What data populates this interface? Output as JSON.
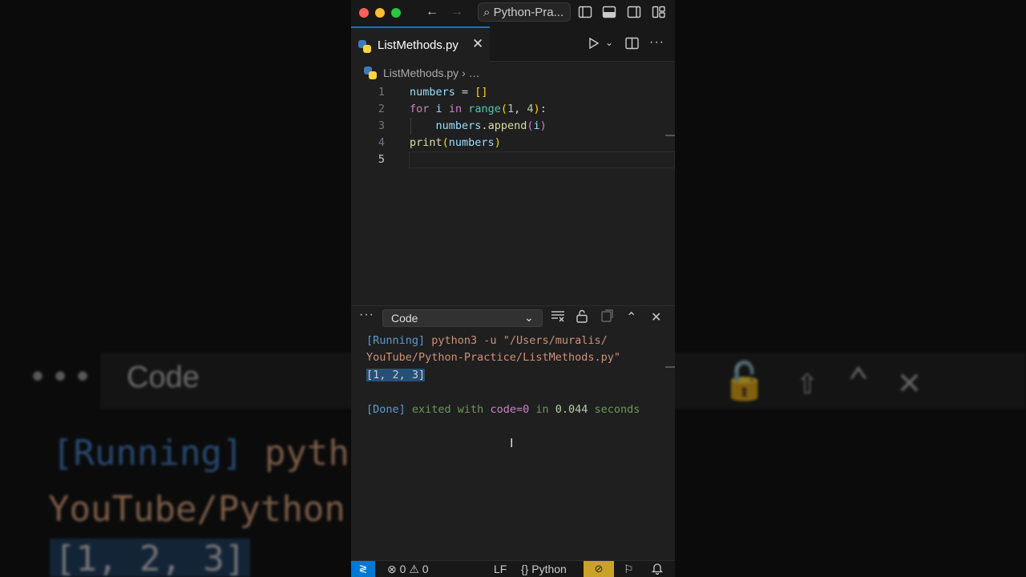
{
  "background": {
    "dots": "•••",
    "code_label": "Code",
    "line1_running": "[Running]",
    "line1_rest": " pyth               muralis/",
    "line2": "YouTube/Python               ethods.py\"",
    "line3": "[1, 2, 3]"
  },
  "titlebar": {
    "search_text": "Python-Pra..."
  },
  "tab": {
    "filename": "ListMethods.py"
  },
  "breadcrumb": {
    "file": "ListMethods.py",
    "more": "…"
  },
  "editor": {
    "line_numbers": [
      "1",
      "2",
      "3",
      "4",
      "5"
    ]
  },
  "panel": {
    "dropdown_value": "Code"
  },
  "output": {
    "running_tag": "[Running]",
    "running_cmd": " python3 -u \"/Users/muralis/",
    "running_path": "YouTube/Python-Practice/ListMethods.py\"",
    "result": "[1, 2, 3]",
    "done_tag": "[Done]",
    "done_text1": " exited with ",
    "done_code": "code=0",
    "done_text2": " in ",
    "done_time": "0.044",
    "done_text3": " seconds"
  },
  "statusbar": {
    "errors": "0",
    "warnings": "0",
    "eol": "LF",
    "language": "Python"
  },
  "colors": {
    "accent": "#0078d4",
    "copilot": "#c9a227"
  }
}
